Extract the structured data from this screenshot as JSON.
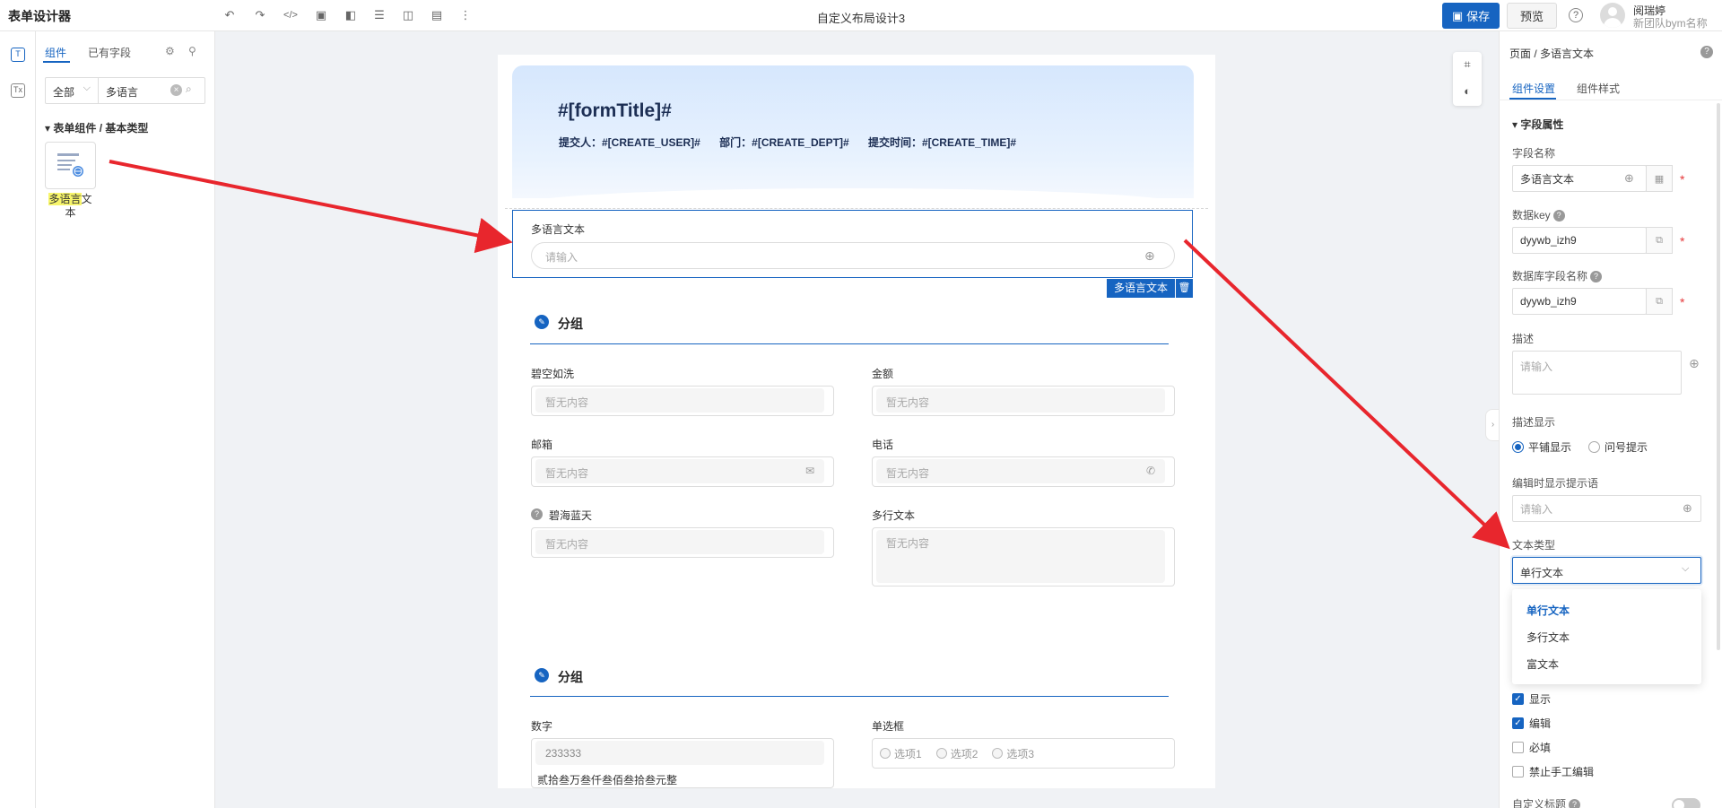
{
  "app": {
    "title": "表单设计器",
    "doc_title": "自定义布局设计3"
  },
  "toolbar": {
    "icons": [
      "undo-icon",
      "redo-icon",
      "code-icon",
      "image-icon",
      "layout-icon",
      "database-icon",
      "chart-icon",
      "note-icon",
      "more-icon"
    ],
    "save_label": "保存",
    "preview_label": "预览",
    "help_label": "?"
  },
  "user": {
    "name": "阅瑞婷",
    "team": "新团队bym名称"
  },
  "rail": {
    "text_icon_label": "T",
    "tx_icon_label": "Tx"
  },
  "left_panel": {
    "tabs": [
      "组件",
      "已有字段"
    ],
    "filter": "全部",
    "search_value": "多语言",
    "category": "表单组件 / 基本类型",
    "component": {
      "label_highlight": "多语言",
      "label_rest": "文本"
    }
  },
  "form": {
    "title": "#[formTitle]#",
    "meta": [
      "提交人：#[CREATE_USER]#",
      "部门：#[CREATE_DEPT]#",
      "提交时间：#[CREATE_TIME]#"
    ],
    "selected_field": {
      "label": "多语言文本",
      "placeholder": "请输入",
      "tag": "多语言文本"
    },
    "group1": {
      "title": "分组",
      "fields": [
        {
          "label": "碧空如洗",
          "placeholder": "暂无内容"
        },
        {
          "label": "金额",
          "placeholder": "暂无内容"
        },
        {
          "label": "邮箱",
          "placeholder": "暂无内容"
        },
        {
          "label": "电话",
          "placeholder": "暂无内容"
        },
        {
          "label": "碧海蓝天",
          "placeholder": "暂无内容"
        },
        {
          "label": "多行文本",
          "placeholder": "暂无内容"
        }
      ]
    },
    "group2": {
      "title": "分组",
      "number_label": "数字",
      "number_value": "233333",
      "number_caption": "贰拾叁万叁仟叁佰叁拾叁元整",
      "radio_label": "单选框",
      "radio_options": [
        "选项1",
        "选项2",
        "选项3"
      ]
    }
  },
  "right_panel": {
    "breadcrumb": "页面 / 多语言文本",
    "tabs": [
      "组件设置",
      "组件样式"
    ],
    "section": "字段属性",
    "field_name_label": "字段名称",
    "field_name_value": "多语言文本",
    "data_key_label": "数据key",
    "data_key_value": "dyywb_izh9",
    "db_field_label": "数据库字段名称",
    "db_field_value": "dyywb_izh9",
    "desc_label": "描述",
    "desc_placeholder": "请输入",
    "desc_display_label": "描述显示",
    "desc_display_options": [
      "平铺显示",
      "问号提示"
    ],
    "edit_hint_label": "编辑时显示提示语",
    "edit_hint_placeholder": "请输入",
    "text_type_label": "文本类型",
    "text_type_value": "单行文本",
    "text_type_options": [
      "单行文本",
      "多行文本",
      "富文本"
    ],
    "checkboxes": [
      {
        "label": "显示",
        "checked": true
      },
      {
        "label": "编辑",
        "checked": true
      },
      {
        "label": "必填",
        "checked": false
      },
      {
        "label": "禁止手工编辑",
        "checked": false
      }
    ],
    "custom_title_label": "自定义标题"
  },
  "colors": {
    "primary": "#1664c1",
    "arrow": "#e8262d",
    "highlight": "#f7f56b"
  }
}
